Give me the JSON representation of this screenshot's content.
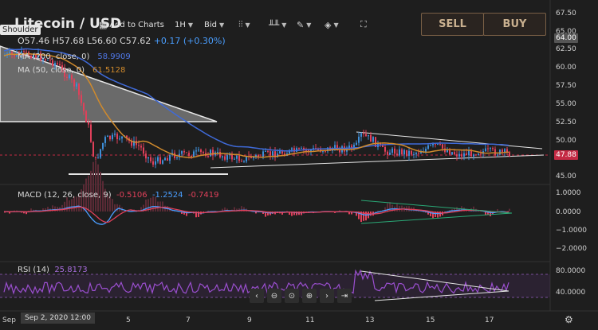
{
  "header": {
    "title": "Litecoin / USD",
    "shoulder_tag": "Shoulder",
    "add_to_charts": "Add to Charts",
    "interval": "1H",
    "price_type": "Bid",
    "sell": "SELL",
    "buy": "BUY"
  },
  "ohlc": {
    "open": "O57.46",
    "high": "H57.68",
    "low": "L56.60",
    "close": "C57.62",
    "change": "+0.17 (+0.30%)"
  },
  "indicators": {
    "ma200": {
      "label": "MA (200, close, 0)",
      "value": "58.9909",
      "color": "#3f6ad8"
    },
    "ma50": {
      "label": "MA (50, close, 0)",
      "value": "61.5128",
      "color": "#d08a2c"
    },
    "macd": {
      "label": "MACD (12, 26, close, 9)",
      "v1": "-0.5106",
      "v2": "-1.2524",
      "v3": "-0.7419"
    },
    "rsi": {
      "label": "RSI (14)",
      "value": "25.8173"
    }
  },
  "axes": {
    "price_ticks": [
      "67.50",
      "65.00",
      "62.50",
      "60.00",
      "57.50",
      "55.00",
      "52.50",
      "50.00",
      "45.00"
    ],
    "price_badge_top": "64.00",
    "price_badge_current": "47.88",
    "macd_ticks": [
      "1.0000",
      "0.0000",
      "−1.0000",
      "−2.0000"
    ],
    "rsi_ticks": [
      "80.0000",
      "40.0000"
    ],
    "x_labels": [
      "Sep",
      "5",
      "7",
      "9",
      "11",
      "13",
      "15",
      "17"
    ],
    "time_cursor": "Sep 2, 2020   12:00"
  },
  "colors": {
    "bg": "#1e1e1e",
    "up": "#3d8ed8",
    "down": "#e0405a",
    "ma200": "#3f6ad8",
    "ma50": "#d08a2c",
    "rsi": "#9b4fd0",
    "badge_current": "#c42a44",
    "badge_top": "#555555"
  },
  "nav_buttons": [
    "chevron-left-icon",
    "zoom-out-icon",
    "zoom-reset-icon",
    "zoom-in-icon",
    "chevron-right-icon",
    "jump-end-icon"
  ]
}
